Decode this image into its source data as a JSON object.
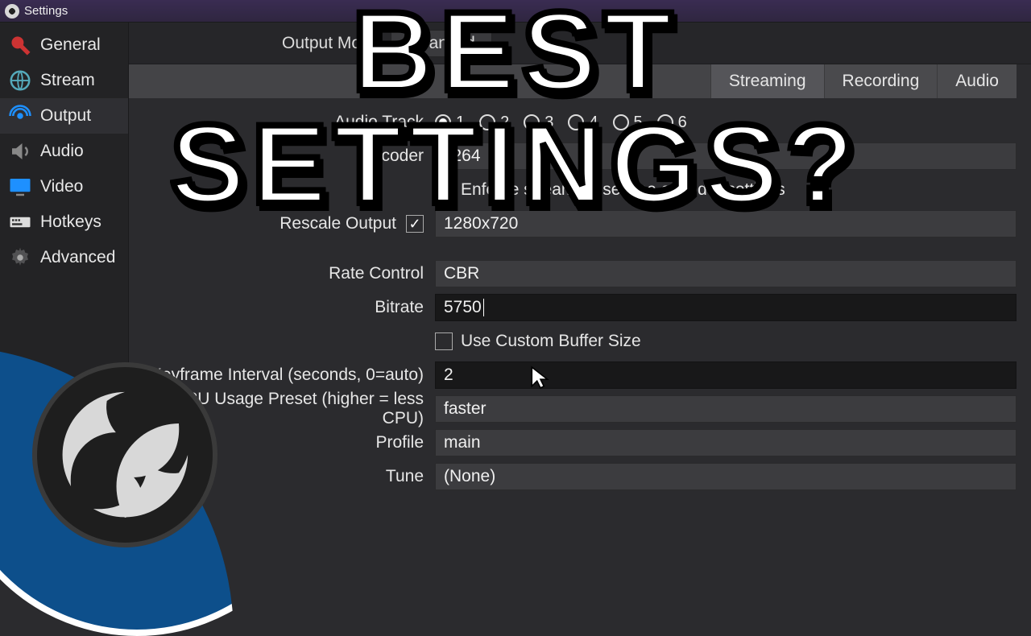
{
  "window": {
    "title": "Settings"
  },
  "overlay": {
    "headline": "BEST SETTINGS?"
  },
  "modebar": {
    "label": "Output Mode",
    "value": "Advanced"
  },
  "sidebar": {
    "items": [
      {
        "label": "General"
      },
      {
        "label": "Stream"
      },
      {
        "label": "Output"
      },
      {
        "label": "Audio"
      },
      {
        "label": "Video"
      },
      {
        "label": "Hotkeys"
      },
      {
        "label": "Advanced"
      }
    ],
    "selected_index": 2
  },
  "tabs": {
    "items": [
      {
        "label": "Streaming"
      },
      {
        "label": "Recording"
      },
      {
        "label": "Audio"
      }
    ],
    "active_index": 0
  },
  "form": {
    "audio_track": {
      "label": "Audio Track",
      "options": [
        "1",
        "2",
        "3",
        "4",
        "5",
        "6"
      ],
      "selected": "1"
    },
    "encoder": {
      "label": "Encoder",
      "value": "x264"
    },
    "enforce": {
      "label": "Enforce streaming service encoder settings",
      "checked": true
    },
    "rescale": {
      "label": "Rescale Output",
      "checked": true,
      "value": "1280x720"
    },
    "rate_control": {
      "label": "Rate Control",
      "value": "CBR"
    },
    "bitrate": {
      "label": "Bitrate",
      "value": "5750"
    },
    "custom_buffer": {
      "label": "Use Custom Buffer Size",
      "checked": false
    },
    "keyframe": {
      "label": "Keyframe Interval (seconds, 0=auto)",
      "value": "2"
    },
    "cpu_preset": {
      "label": "CPU Usage Preset (higher = less CPU)",
      "value": "faster"
    },
    "profile": {
      "label": "Profile",
      "value": "main"
    },
    "tune": {
      "label": "Tune",
      "value": "(None)"
    }
  }
}
